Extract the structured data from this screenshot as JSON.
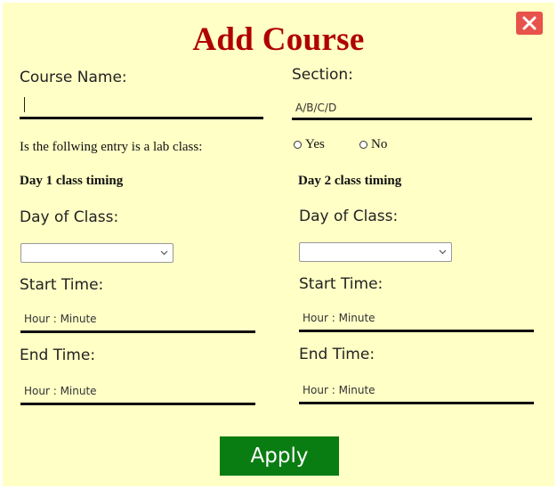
{
  "dialog": {
    "title": "Add Course",
    "close_icon": "close-icon",
    "colors": {
      "background": "#ffffc6",
      "title": "#b00000",
      "close": "#e8524a",
      "apply": "#0a7d12"
    }
  },
  "course_name": {
    "label": "Course Name:",
    "value": ""
  },
  "section": {
    "label": "Section:",
    "placeholder": "A/B/C/D"
  },
  "lab": {
    "question": "Is the follwing entry is a lab class:",
    "options": [
      "Yes",
      "No"
    ]
  },
  "day1": {
    "heading": "Day 1 class timing",
    "day_label": "Day of Class:",
    "selected_day": "",
    "start_label": "Start Time:",
    "start_placeholder": "Hour : Minute",
    "end_label": "End Time:",
    "end_placeholder": "Hour : Minute"
  },
  "day2": {
    "heading": "Day 2 class timing",
    "day_label": "Day of Class:",
    "selected_day": "",
    "start_label": "Start Time:",
    "start_placeholder": "Hour : Minute",
    "end_label": "End Time:",
    "end_placeholder": "Hour : Minute"
  },
  "actions": {
    "apply_label": "Apply"
  }
}
